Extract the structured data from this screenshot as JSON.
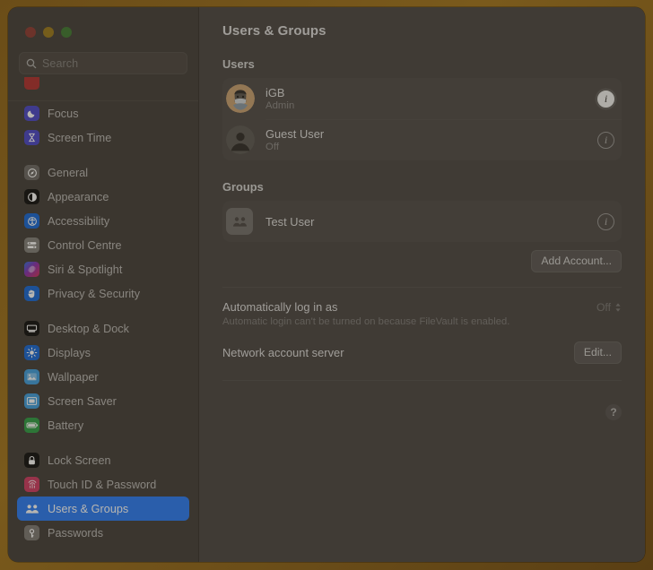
{
  "window": {
    "traffic_lights": [
      "close",
      "minimize",
      "zoom"
    ]
  },
  "sidebar": {
    "search": {
      "placeholder": "Search",
      "value": "",
      "icon": "search-icon"
    },
    "items": [
      {
        "label": "",
        "icon": "notifications-icon",
        "clipped": true,
        "selected": false
      },
      {
        "label": "Focus",
        "icon": "focus-icon",
        "selected": false
      },
      {
        "label": "Screen Time",
        "icon": "screen-time-icon",
        "selected": false
      },
      {
        "label": "General",
        "icon": "general-icon",
        "selected": false
      },
      {
        "label": "Appearance",
        "icon": "appearance-icon",
        "selected": false
      },
      {
        "label": "Accessibility",
        "icon": "accessibility-icon",
        "selected": false
      },
      {
        "label": "Control Centre",
        "icon": "control-centre-icon",
        "selected": false
      },
      {
        "label": "Siri & Spotlight",
        "icon": "siri-icon",
        "selected": false
      },
      {
        "label": "Privacy & Security",
        "icon": "privacy-icon",
        "selected": false
      },
      {
        "label": "Desktop & Dock",
        "icon": "desktop-dock-icon",
        "selected": false
      },
      {
        "label": "Displays",
        "icon": "displays-icon",
        "selected": false
      },
      {
        "label": "Wallpaper",
        "icon": "wallpaper-icon",
        "selected": false
      },
      {
        "label": "Screen Saver",
        "icon": "screen-saver-icon",
        "selected": false
      },
      {
        "label": "Battery",
        "icon": "battery-icon",
        "selected": false
      },
      {
        "label": "Lock Screen",
        "icon": "lock-screen-icon",
        "selected": false
      },
      {
        "label": "Touch ID & Password",
        "icon": "touch-id-icon",
        "selected": false
      },
      {
        "label": "Users & Groups",
        "icon": "users-groups-icon",
        "selected": true
      },
      {
        "label": "Passwords",
        "icon": "passwords-icon",
        "selected": false
      }
    ]
  },
  "main": {
    "title": "Users & Groups",
    "users_section": {
      "label": "Users",
      "rows": [
        {
          "name": "iGB",
          "status": "Admin",
          "avatar": "memoji-avatar",
          "info_label": "i",
          "focused": true
        },
        {
          "name": "Guest User",
          "status": "Off",
          "avatar": "guest-avatar",
          "info_label": "i",
          "focused": false
        }
      ]
    },
    "groups_section": {
      "label": "Groups",
      "rows": [
        {
          "name": "Test User",
          "icon": "group-icon",
          "info_label": "i",
          "focused": false
        }
      ],
      "add_account_label": "Add Account..."
    },
    "auto_login": {
      "title": "Automatically log in as",
      "note": "Automatic login can't be turned on because FileVault is enabled.",
      "value": "Off"
    },
    "network_account_server": {
      "title": "Network account server",
      "edit_label": "Edit..."
    },
    "help_label": "?"
  },
  "colors": {
    "accent": "#2a7cf6",
    "window_bg": "#494541",
    "sidebar_bg": "#443f3a",
    "frame": "#7a5a1c"
  }
}
